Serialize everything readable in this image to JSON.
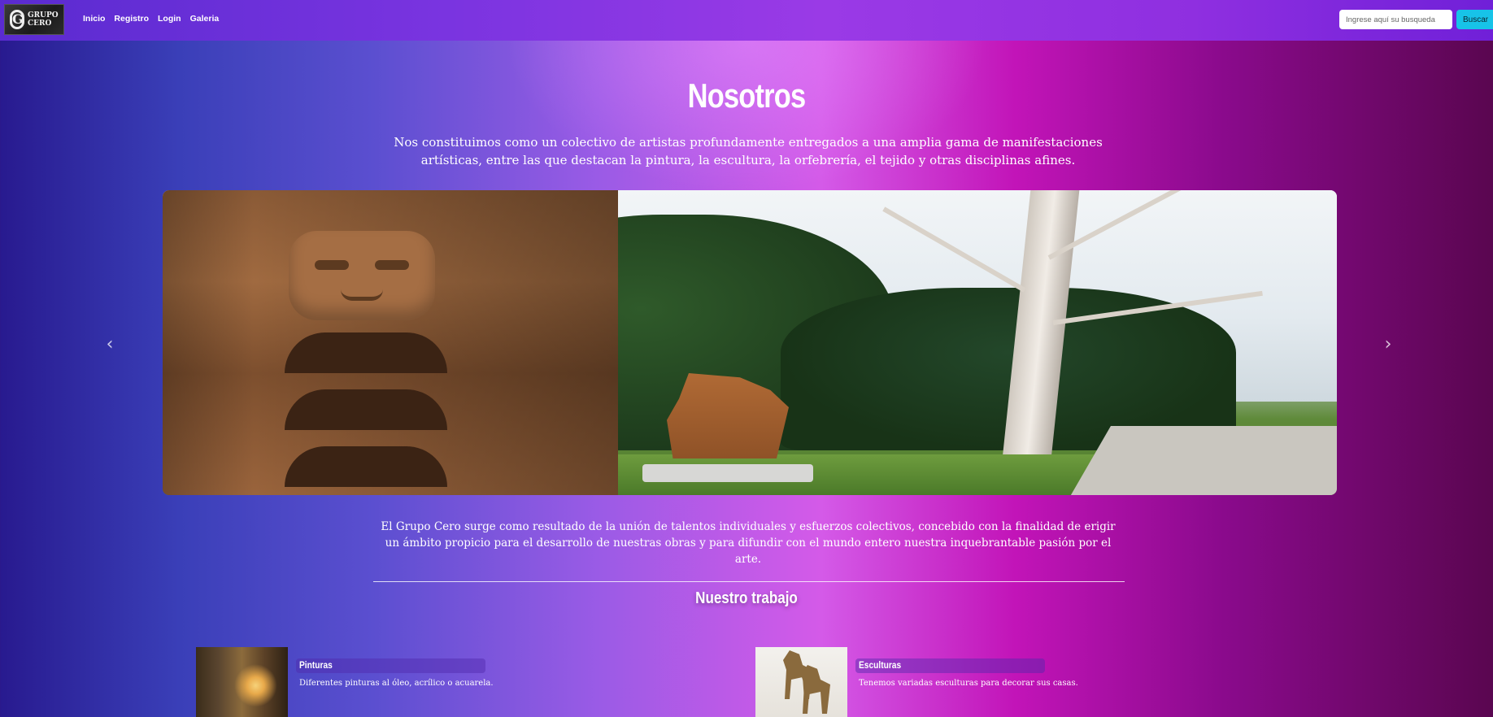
{
  "navbar": {
    "logo_text": [
      "GRUPO",
      "CERO"
    ],
    "logo_mark": "G",
    "links": [
      "Inicio",
      "Registro",
      "Login",
      "Galeria"
    ],
    "search_placeholder": "Ingrese aquí su busqueda",
    "search_button": "Buscar"
  },
  "hero": {
    "title": "Nosotros",
    "intro": "Nos constituimos como un colectivo de artistas profundamente entregados a una amplia gama de manifestaciones artísticas, entre las que destacan la pintura, la escultura, la orfebrería, el tejido y otras disciplinas afines."
  },
  "carousel": {
    "prev_icon": "chevron-left-icon",
    "next_icon": "chevron-right-icon",
    "prev_glyph": "‹",
    "next_glyph": "›"
  },
  "mission": {
    "text": "El Grupo Cero surge como resultado de la unión de talentos individuales y esfuerzos colectivos, concebido con la finalidad de erigir un ámbito propicio para el desarrollo de nuestras obras y para difundir con el mundo entero nuestra inquebrantable pasión por el arte."
  },
  "work": {
    "title": "Nuestro trabajo",
    "cards": [
      {
        "title": "Pinturas",
        "text": "Diferentes pinturas al óleo, acrílico o acuarela."
      },
      {
        "title": "Esculturas",
        "text": "Tenemos variadas esculturas para decorar sus casas."
      }
    ]
  },
  "colors": {
    "accent": "#17c3e8",
    "navbar": "#7a34e0"
  }
}
